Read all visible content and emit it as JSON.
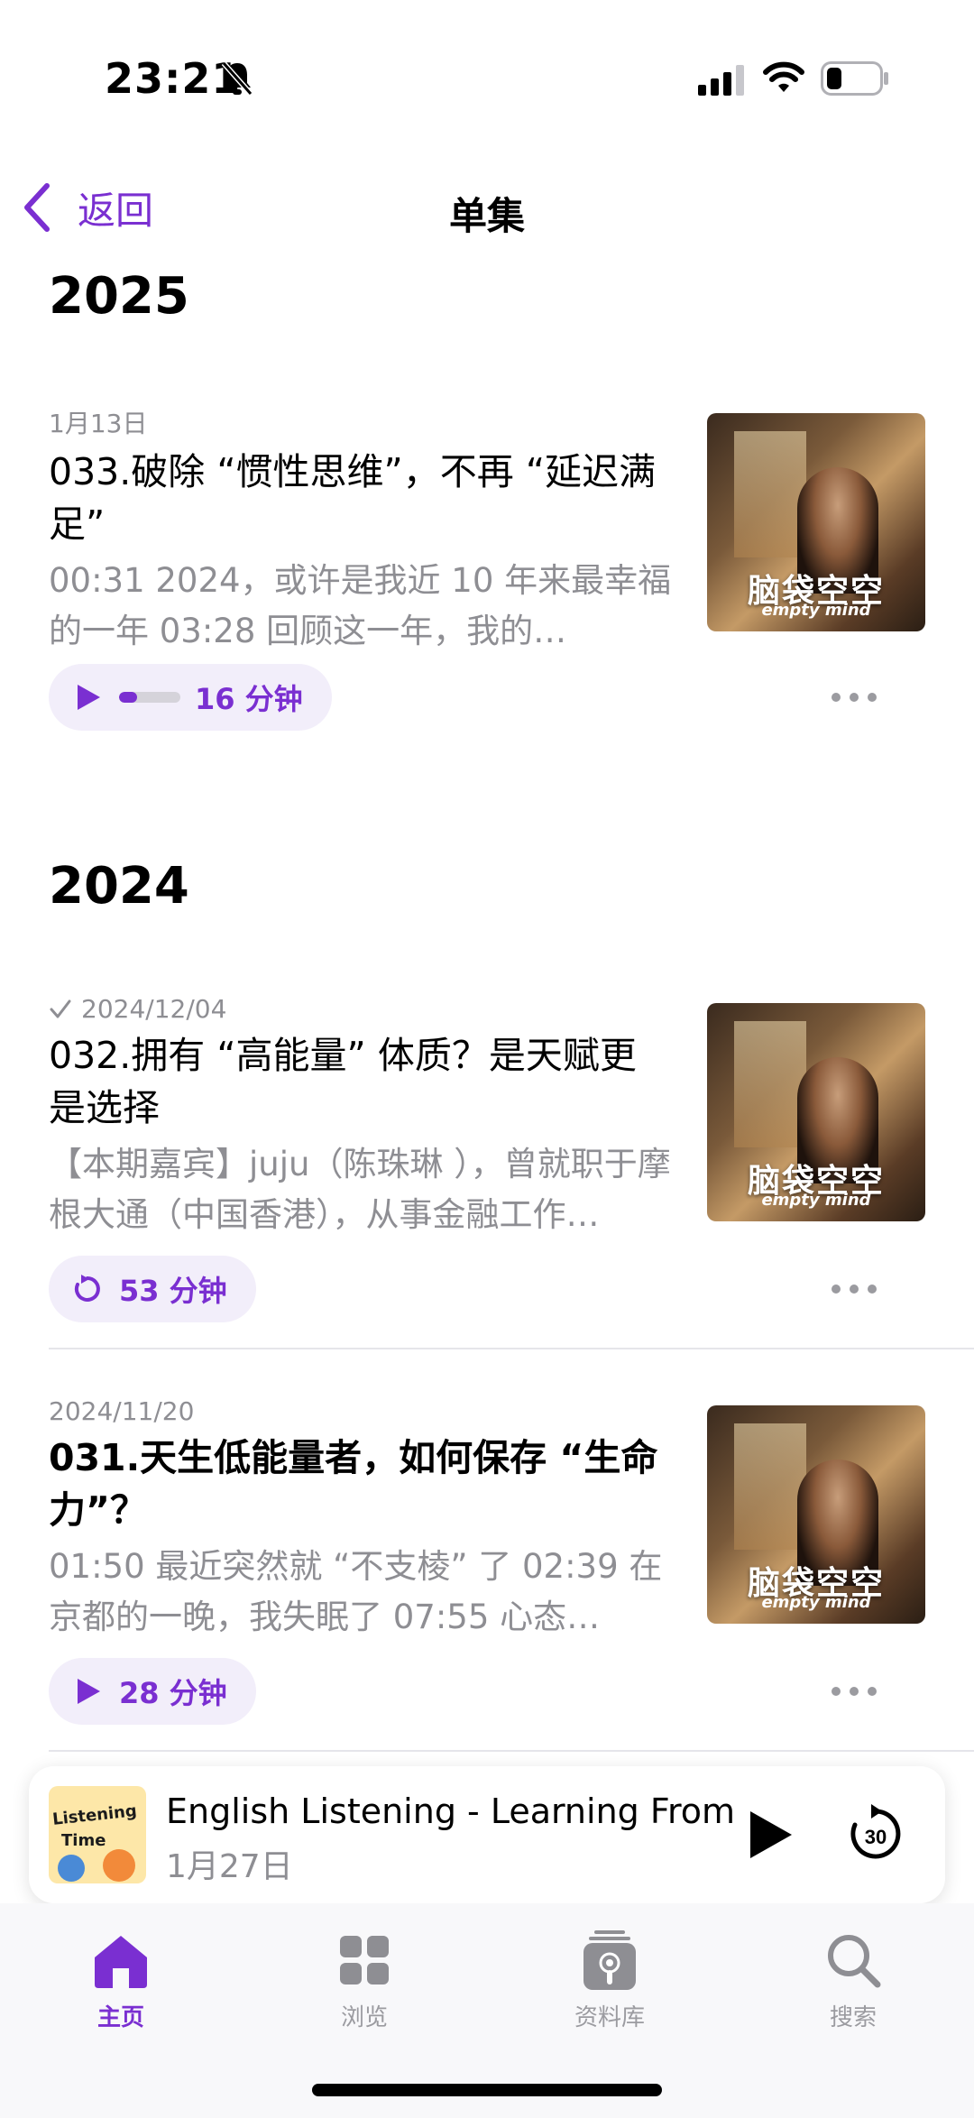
{
  "status_bar": {
    "time": "23:21"
  },
  "nav": {
    "back_label": "返回",
    "title": "单集"
  },
  "sections": [
    {
      "year": "2025",
      "episodes": [
        {
          "date": "1月13日",
          "played": false,
          "title": "033.破除 “惯性思维”，不再 “延迟满足”",
          "description": "00:31 2024，或许是我近 10 年来最幸福的一年 03:28 回顾这一年，我的…",
          "duration": "16 分钟",
          "button_state": "play-in-progress",
          "progress": 0.3,
          "art_title": "脑袋空空",
          "art_subtitle": "empty mind"
        }
      ]
    },
    {
      "year": "2024",
      "episodes": [
        {
          "date": "2024/12/04",
          "played": true,
          "title": "032.拥有 “高能量” 体质？是天赋更是选择",
          "description": "【本期嘉宾】juju（陈珠琳 ），曾就职于摩根大通（中国香港），从事金融工作…",
          "duration": "53 分钟",
          "button_state": "replay",
          "art_title": "脑袋空空",
          "art_subtitle": "empty mind"
        },
        {
          "date": "2024/11/20",
          "played": false,
          "title": "031.天生低能量者，如何保存 “生命力”？",
          "description": "01:50  最近突然就 “不支棱” 了 02:39  在京都的一晚，我失眠了 07:55 心态…",
          "duration": "28 分钟",
          "button_state": "play",
          "art_title": "脑袋空空",
          "art_subtitle": "empty mind"
        }
      ]
    }
  ],
  "mini_player": {
    "title": "English Listening - Learning From",
    "date": "1月27日",
    "art_text_1": "Listening",
    "art_text_2": "Time",
    "skip_seconds": "30"
  },
  "tabs": [
    {
      "label": "主页",
      "icon": "home-icon",
      "active": true
    },
    {
      "label": "浏览",
      "icon": "grid-icon",
      "active": false
    },
    {
      "label": "资料库",
      "icon": "library-icon",
      "active": false
    },
    {
      "label": "搜索",
      "icon": "search-icon",
      "active": false
    }
  ],
  "colors": {
    "accent": "#7a2fd1",
    "secondary_text": "#8e8e93",
    "pill_bg": "#f2eefa"
  }
}
